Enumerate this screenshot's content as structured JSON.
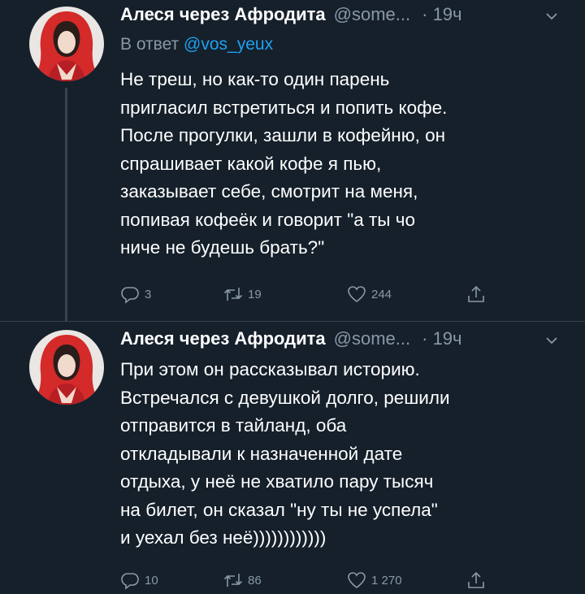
{
  "tweets": [
    {
      "author_name": "Алеся через Афродита",
      "handle": "@some...",
      "time": "· 19ч",
      "reply_prefix": "В ответ",
      "reply_to": "@vos_yeux",
      "lines": [
        "Не треш, но как-то один парень",
        "пригласил встретиться и попить кофе.",
        "После прогулки, зашли в кофейню, он",
        "спрашивает какой кофе я пью,",
        "заказывает себе, смотрит на меня,",
        "попивая кофеёк и говорит \"а ты чо",
        "ниче не будешь брать?\""
      ],
      "replies": "3",
      "retweets": "19",
      "likes": "244"
    },
    {
      "author_name": "Алеся через Афродита",
      "handle": "@some...",
      "time": "· 19ч",
      "lines": [
        "При этом он рассказывал историю.",
        "Встречался с девушкой долго, решили",
        "отправится в тайланд, оба",
        "откладывали к назначенной дате",
        "отдыха, у неё не хватило пару тысяч",
        "на билет, он сказал \"ну ты не успела\"",
        "и уехал без неё))))))))))))"
      ],
      "replies": "10",
      "retweets": "86",
      "likes": "1 270"
    }
  ],
  "colors": {
    "background": "#15202b",
    "secondary_text": "#8899a6",
    "link": "#1da1f2",
    "thread_line": "#38444d"
  },
  "icons": {
    "reply": "reply-icon",
    "retweet": "retweet-icon",
    "like": "like-icon",
    "share": "share-icon",
    "caret": "chevron-down-icon"
  }
}
